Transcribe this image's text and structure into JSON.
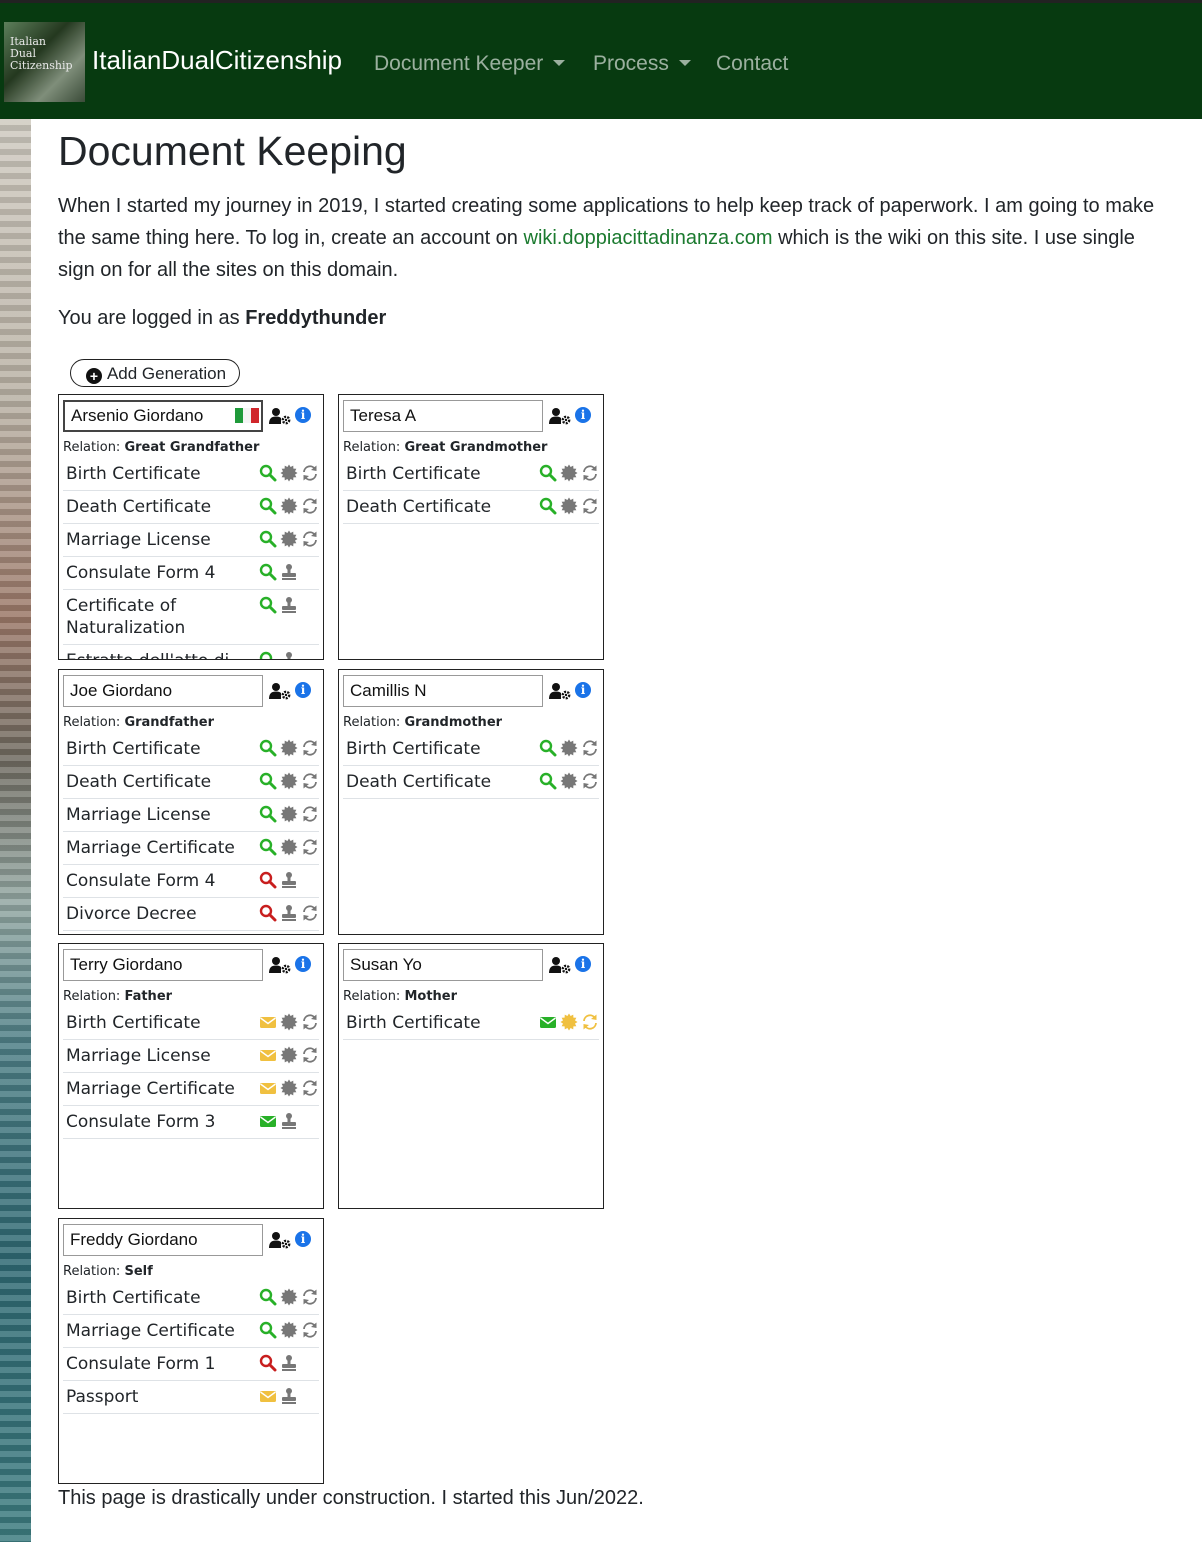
{
  "navbar": {
    "logo_text": "Italian Dual Citizenship",
    "brand": "ItalianDualCitizenship",
    "items": [
      {
        "label": "Document Keeper",
        "dropdown": true
      },
      {
        "label": "Process",
        "dropdown": true
      },
      {
        "label": "Contact",
        "dropdown": false
      }
    ]
  },
  "page": {
    "title": "Document Keeping",
    "intro_before_link": "When I started my journey in 2019, I started creating some applications to help keep track of paperwork. I am going to make the same thing here. To log in, create an account on ",
    "intro_link": "wiki.doppiacittadinanza.com",
    "intro_after_link": " which is the wiki on this site. I use single sign on for all the sites on this domain.",
    "logged_prefix": "You are logged in as ",
    "username": "Freddythunder",
    "add_generation": "Add Generation",
    "footer": "This page is drastically under construction. I started this Jun/2022."
  },
  "colors": {
    "navbar_bg": "#073a10",
    "found": "#28b028",
    "missing": "#c81e1e",
    "pending": "#f0c040",
    "received": "#28b028",
    "neutral": "#777777",
    "info": "#1a73e8",
    "link": "#1b7a2f"
  },
  "relation_label": "Relation:",
  "people": [
    {
      "name": "Arsenio Giordano",
      "relation": "Great Grandfather",
      "flag": true,
      "active": true,
      "docs": [
        {
          "label": "Birth Certificate",
          "icons": [
            "search-green",
            "apostille-gray",
            "translate-gray"
          ]
        },
        {
          "label": "Death Certificate",
          "icons": [
            "search-green",
            "apostille-gray",
            "translate-gray"
          ]
        },
        {
          "label": "Marriage License",
          "icons": [
            "search-green",
            "apostille-gray",
            "translate-gray"
          ]
        },
        {
          "label": "Consulate Form 4",
          "icons": [
            "search-green",
            "stamp-gray"
          ]
        },
        {
          "label": "Certificate of Naturalization",
          "icons": [
            "search-green",
            "stamp-gray"
          ]
        },
        {
          "label": "Estratto dell'atto di",
          "icons": [
            "search-green",
            "stamp-gray"
          ]
        }
      ]
    },
    {
      "name": "Teresa A",
      "relation": "Great Grandmother",
      "docs": [
        {
          "label": "Birth Certificate",
          "icons": [
            "search-green",
            "apostille-gray",
            "translate-gray"
          ]
        },
        {
          "label": "Death Certificate",
          "icons": [
            "search-green",
            "apostille-gray",
            "translate-gray"
          ]
        }
      ]
    },
    {
      "name": "Joe Giordano",
      "relation": "Grandfather",
      "docs": [
        {
          "label": "Birth Certificate",
          "icons": [
            "search-green",
            "apostille-gray",
            "translate-gray"
          ]
        },
        {
          "label": "Death Certificate",
          "icons": [
            "search-green",
            "apostille-gray",
            "translate-gray"
          ]
        },
        {
          "label": "Marriage License",
          "icons": [
            "search-green",
            "apostille-gray",
            "translate-gray"
          ]
        },
        {
          "label": "Marriage Certificate",
          "icons": [
            "search-green",
            "apostille-gray",
            "translate-gray"
          ]
        },
        {
          "label": "Consulate Form 4",
          "icons": [
            "search-red",
            "stamp-gray"
          ]
        },
        {
          "label": "Divorce Decree",
          "icons": [
            "search-red",
            "stamp-gray",
            "translate-gray"
          ]
        }
      ]
    },
    {
      "name": "Camillis N",
      "relation": "Grandmother",
      "docs": [
        {
          "label": "Birth Certificate",
          "icons": [
            "search-green",
            "apostille-gray",
            "translate-gray"
          ]
        },
        {
          "label": "Death Certificate",
          "icons": [
            "search-green",
            "apostille-gray",
            "translate-gray"
          ]
        }
      ]
    },
    {
      "name": "Terry Giordano",
      "relation": "Father",
      "docs": [
        {
          "label": "Birth Certificate",
          "icons": [
            "mail-yellow",
            "apostille-gray",
            "translate-gray"
          ]
        },
        {
          "label": "Marriage License",
          "icons": [
            "mail-yellow",
            "apostille-gray",
            "translate-gray"
          ]
        },
        {
          "label": "Marriage Certificate",
          "icons": [
            "mail-yellow",
            "apostille-gray",
            "translate-gray"
          ]
        },
        {
          "label": "Consulate Form 3",
          "icons": [
            "mail-green",
            "stamp-gray"
          ]
        }
      ]
    },
    {
      "name": "Susan Yo",
      "relation": "Mother",
      "docs": [
        {
          "label": "Birth Certificate",
          "icons": [
            "mail-green",
            "apostille-yellow",
            "translate-yellow"
          ]
        }
      ]
    },
    {
      "name": "Freddy Giordano",
      "relation": "Self",
      "docs": [
        {
          "label": "Birth Certificate",
          "icons": [
            "search-green",
            "apostille-gray",
            "translate-gray"
          ]
        },
        {
          "label": "Marriage Certificate",
          "icons": [
            "search-green",
            "apostille-gray",
            "translate-gray"
          ]
        },
        {
          "label": "Consulate Form 1",
          "icons": [
            "search-red",
            "stamp-gray"
          ]
        },
        {
          "label": "Passport",
          "icons": [
            "mail-yellow",
            "stamp-gray"
          ]
        }
      ]
    }
  ]
}
